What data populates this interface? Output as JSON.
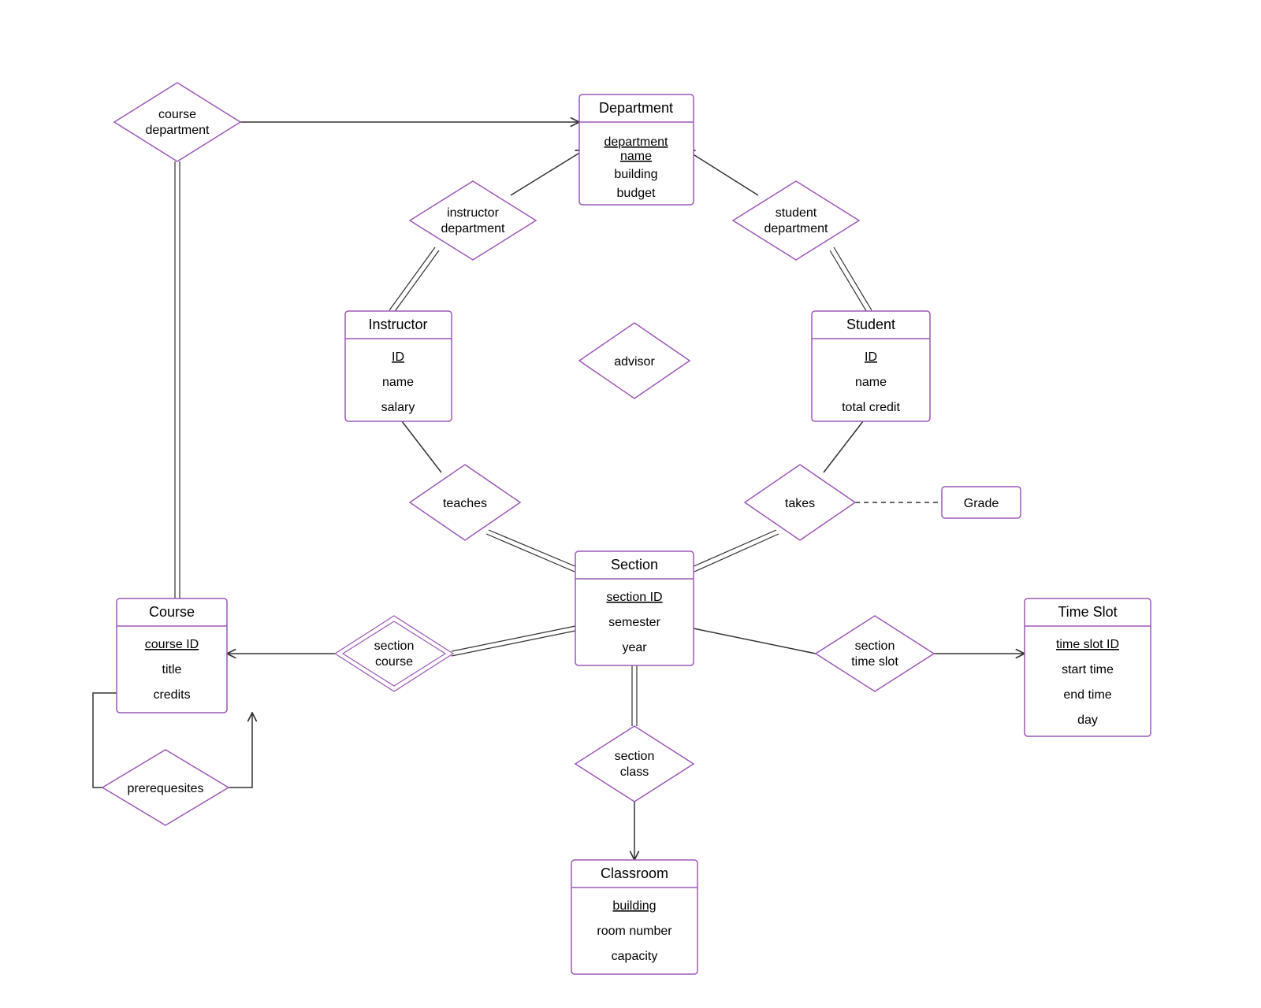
{
  "entities": {
    "department": {
      "title": "Department",
      "attrs": [
        "department name",
        "building",
        "budget"
      ],
      "keyIndex": 0
    },
    "instructor": {
      "title": "Instructor",
      "attrs": [
        "ID",
        "name",
        "salary"
      ],
      "keyIndex": 0
    },
    "student": {
      "title": "Student",
      "attrs": [
        "ID",
        "name",
        "total credit"
      ],
      "keyIndex": 0
    },
    "section": {
      "title": "Section",
      "attrs": [
        "section ID",
        "semester",
        "year"
      ],
      "keyIndex": 0
    },
    "course": {
      "title": "Course",
      "attrs": [
        "course ID",
        "title",
        "credits"
      ],
      "keyIndex": 0
    },
    "classroom": {
      "title": "Classroom",
      "attrs": [
        "building",
        "room number",
        "capacity"
      ],
      "keyIndex": 0
    },
    "timeslot": {
      "title": "Time Slot",
      "attrs": [
        "time slot ID",
        "start time",
        "end time",
        "day"
      ],
      "keyIndex": 0
    }
  },
  "relationships": {
    "course_department": {
      "label1": "course",
      "label2": "department"
    },
    "instructor_department": {
      "label1": "instructor",
      "label2": "department"
    },
    "student_department": {
      "label1": "student",
      "label2": "department"
    },
    "advisor": {
      "label1": "advisor",
      "label2": ""
    },
    "teaches": {
      "label1": "teaches",
      "label2": ""
    },
    "takes": {
      "label1": "takes",
      "label2": ""
    },
    "section_course": {
      "label1": "section",
      "label2": "course"
    },
    "section_time_slot": {
      "label1": "section",
      "label2": "time slot"
    },
    "section_class": {
      "label1": "section",
      "label2": "class"
    },
    "prerequisites": {
      "label1": "prerequesites",
      "label2": ""
    }
  },
  "assoc": {
    "grade": {
      "label": "Grade"
    }
  }
}
